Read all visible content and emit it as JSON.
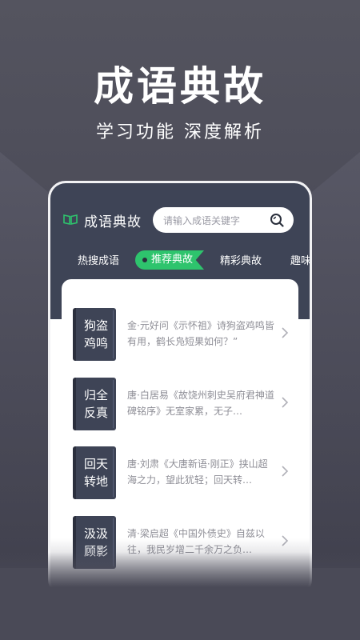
{
  "hero": {
    "title": "成语典故",
    "subtitle": "学习功能 深度解析"
  },
  "app": {
    "name": "成语典故",
    "logo_icon": "book-icon",
    "search_placeholder": "请输入成语关键字",
    "accent_color": "#2ec46d",
    "header_color": "#3e4456"
  },
  "tabs": [
    {
      "label": "热搜成语",
      "active": false
    },
    {
      "label": "推荐典故",
      "active": true
    },
    {
      "label": "精彩典故",
      "active": false
    },
    {
      "label": "趣味",
      "active": false
    }
  ],
  "items": [
    {
      "idiom": "狗盗鸡鸣",
      "desc": "金·元好问《示怀祖》诗狗盗鸡鸣皆有用，鹤长凫短果如何？”"
    },
    {
      "idiom": "归全反真",
      "desc": "唐·白居易《故饶州刺史吴府君神道碑铭序》无室家累，无子…"
    },
    {
      "idiom": "回天转地",
      "desc": "唐·刘肃《大唐新语·刚正》挟山超海之力，望此犹轻；回天转…"
    },
    {
      "idiom": "汲汲顾影",
      "desc": "清·梁启超《中国外债史》自兹以往，我民岁增二千余万之负…"
    }
  ]
}
